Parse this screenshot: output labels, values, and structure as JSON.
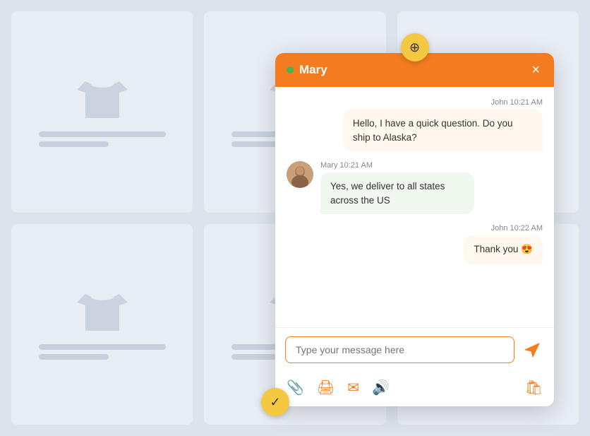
{
  "background": {
    "cards": [
      {
        "id": 1
      },
      {
        "id": 2
      },
      {
        "id": 3
      },
      {
        "id": 4
      },
      {
        "id": 5
      },
      {
        "id": 6
      }
    ]
  },
  "chat": {
    "header": {
      "name": "Mary",
      "close_label": "×",
      "online": true
    },
    "messages": [
      {
        "id": 1,
        "type": "outgoing",
        "sender": "John",
        "time": "10:21 AM",
        "text": "Hello, I have a quick question. Do you ship to Alaska?"
      },
      {
        "id": 2,
        "type": "incoming",
        "sender": "Mary",
        "time": "10:21 AM",
        "text": "Yes, we deliver to all states across the US"
      },
      {
        "id": 3,
        "type": "outgoing",
        "sender": "John",
        "time": "10:22 AM",
        "text": "Thank you 😍"
      }
    ],
    "input": {
      "placeholder": "Type your message here"
    },
    "toolbar": {
      "attachment_label": "📎",
      "print_label": "🖨",
      "email_label": "✉",
      "volume_label": "🔊",
      "bag_label": "🛍"
    },
    "drag_handle": "⊕",
    "check_icon": "✓",
    "send_icon_color": "#f47b20"
  }
}
